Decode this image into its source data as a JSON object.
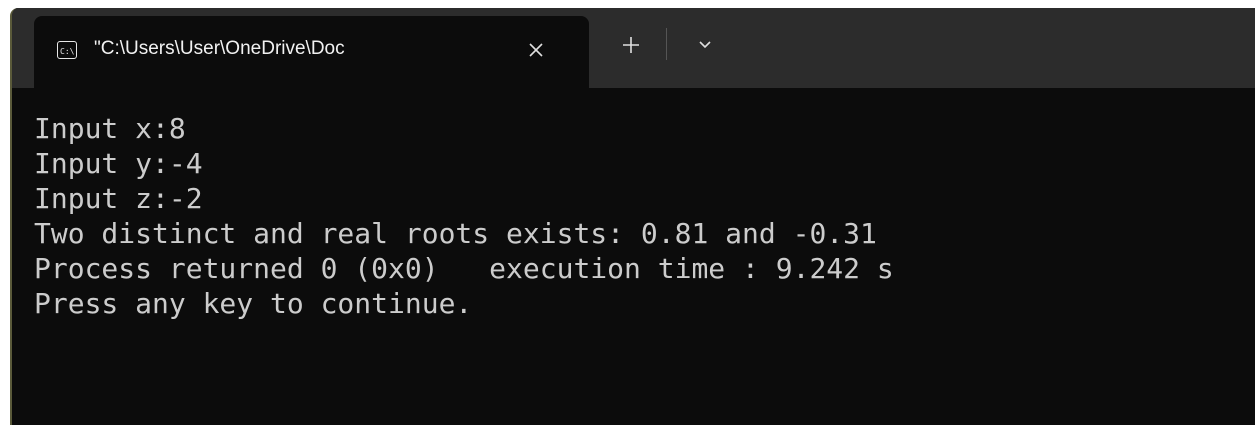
{
  "tab": {
    "title": "\"C:\\Users\\User\\OneDrive\\Doc",
    "icon": "console-icon"
  },
  "controls": {
    "close_icon": "close-icon",
    "new_tab_icon": "plus-icon",
    "dropdown_icon": "chevron-down-icon"
  },
  "terminal": {
    "lines": [
      "Input x:8",
      "Input y:-4",
      "Input z:-2",
      "Two distinct and real roots exists: 0.81 and -0.31",
      "Process returned 0 (0x0)   execution time : 9.242 s",
      "Press any key to continue."
    ]
  },
  "colors": {
    "terminal_bg": "#0c0c0c",
    "tabbar_bg": "#2c2c2c",
    "text": "#cccccc"
  }
}
